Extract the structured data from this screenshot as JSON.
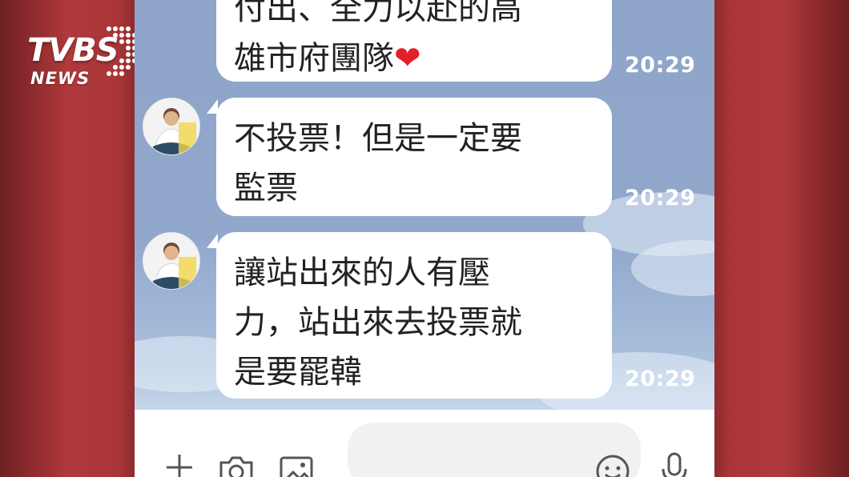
{
  "logo": {
    "brand": "TVBS",
    "sub": "NEWS"
  },
  "messages": [
    {
      "lines": [
        "付出、全力以赴的高",
        "雄市府團隊"
      ],
      "emoji": "❤",
      "time": "20:29"
    },
    {
      "lines": [
        "不投票！但是一定要",
        "監票"
      ],
      "time": "20:29"
    },
    {
      "lines": [
        "讓站出來的人有壓",
        "力，站出來去投票就",
        "是要罷韓"
      ],
      "time": "20:29"
    }
  ],
  "input": {
    "icons": [
      "plus-icon",
      "camera-icon",
      "image-icon",
      "emoji-icon",
      "microphone-icon"
    ]
  },
  "colors": {
    "chat_bg": "#91a8cc",
    "bubble": "#ffffff",
    "heart": "#e3202a",
    "frame": "#a83538"
  }
}
